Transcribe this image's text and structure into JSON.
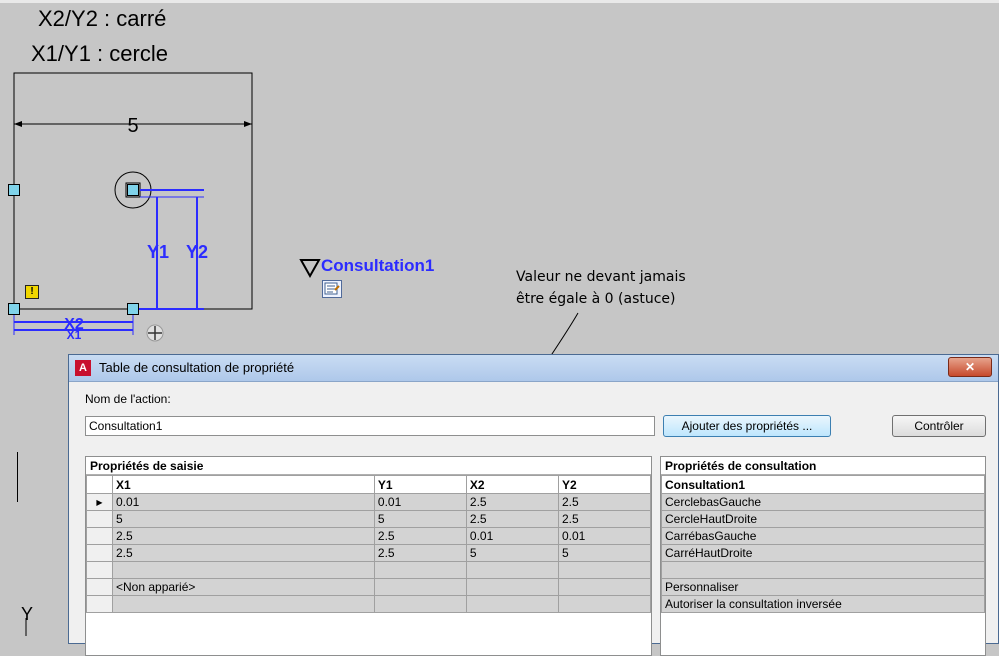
{
  "canvas": {
    "label_x2y2": "X2/Y2 : carré",
    "label_x1y1": "X1/Y1 : cercle",
    "dimension_value": "5",
    "param_y1": "Y1",
    "param_y2": "Y2",
    "param_x2": "X2",
    "param_x1": "X1",
    "warning_mark": "!",
    "consultation_label": "Consultation1",
    "annotation_line1": "Valeur ne devant jamais",
    "annotation_line2": "être égale à 0 (astuce)",
    "ucs_y": "Y"
  },
  "dialog": {
    "app_icon": "A",
    "title": "Table de consultation de propriété",
    "close_label": "✕",
    "action_name_label": "Nom de l'action:",
    "action_name_value": "Consultation1",
    "add_properties_button": "Ajouter des propriétés ...",
    "check_button": "Contrôler",
    "input_props": {
      "title": "Propriétés de saisie",
      "columns": [
        "X1",
        "Y1",
        "X2",
        "Y2"
      ],
      "rows": [
        [
          "0.01",
          "0.01",
          "2.5",
          "2.5"
        ],
        [
          "5",
          "5",
          "2.5",
          "2.5"
        ],
        [
          "2.5",
          "2.5",
          "0.01",
          "0.01"
        ],
        [
          "2.5",
          "2.5",
          "5",
          "5"
        ],
        [
          "",
          "",
          "",
          ""
        ],
        [
          "<Non apparié>",
          "",
          "",
          ""
        ],
        [
          "",
          "",
          "",
          ""
        ]
      ]
    },
    "lookup_props": {
      "title": "Propriétés de consultation",
      "column": "Consultation1",
      "rows": [
        "CerclebasGauche",
        "CercleHautDroite",
        "CarrébasGauche",
        "CarréHautDroite",
        "",
        "Personnaliser",
        "Autoriser la consultation inversée"
      ]
    }
  }
}
